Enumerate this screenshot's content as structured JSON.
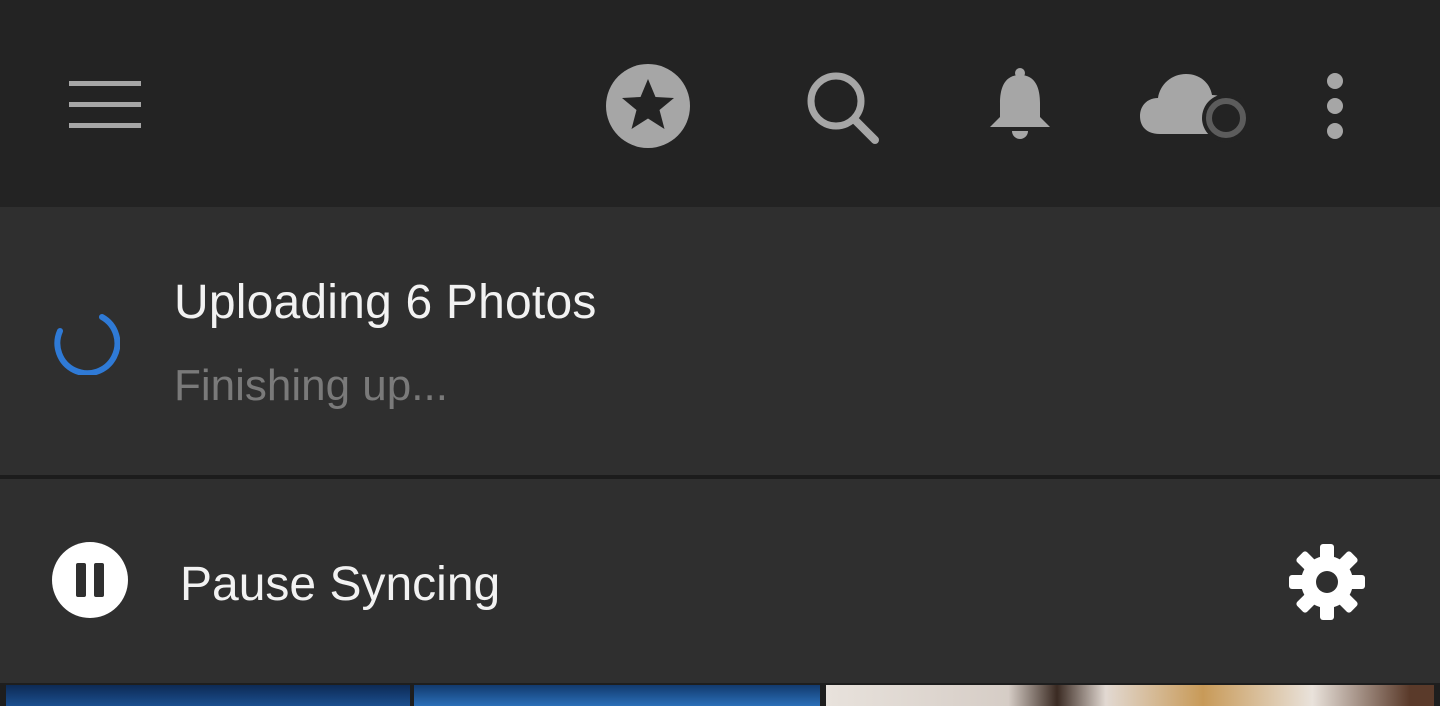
{
  "topbar": {
    "icons": {
      "menu": "hamburger-menu-icon",
      "star": "star-badge-icon",
      "search": "search-icon",
      "bell": "bell-icon",
      "cloud": "cloud-sync-icon",
      "more": "more-vertical-icon"
    }
  },
  "upload": {
    "title": "Uploading 6 Photos",
    "status": "Finishing up...",
    "spinner_color": "#2f7ad6"
  },
  "pause": {
    "label": "Pause Syncing",
    "icon": "pause-circle-icon",
    "settings_icon": "gear-icon"
  },
  "colors": {
    "topbar_bg": "#232323",
    "panel_bg": "#2f2f2f",
    "icon_gray": "#a6a6a6",
    "text_primary": "#f2f2f2",
    "text_secondary": "#7a7a7a"
  }
}
